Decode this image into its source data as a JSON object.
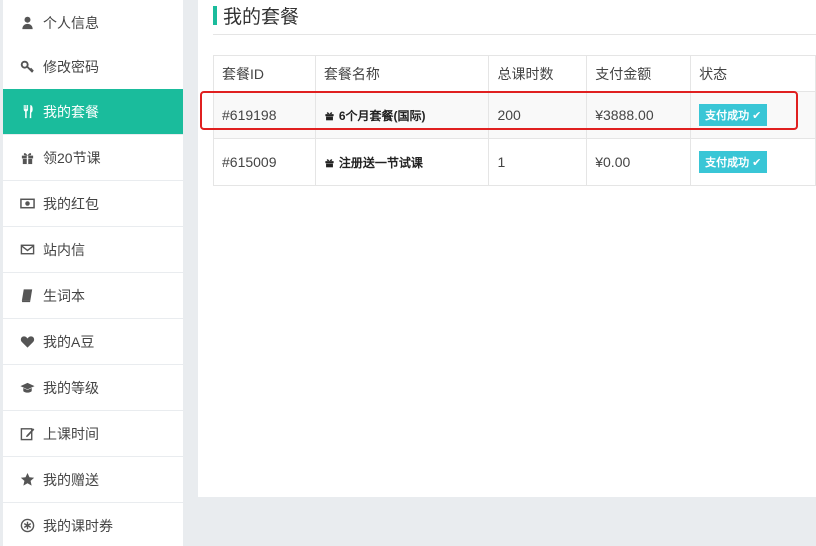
{
  "sidebar": {
    "items": [
      {
        "label": "个人信息",
        "icon": "user-icon"
      },
      {
        "label": "修改密码",
        "icon": "key-icon"
      },
      {
        "label": "我的套餐",
        "icon": "cutlery-icon",
        "active": true
      },
      {
        "label": "领20节课",
        "icon": "gift-icon"
      },
      {
        "label": "我的红包",
        "icon": "money-icon"
      },
      {
        "label": "站内信",
        "icon": "envelope-icon"
      },
      {
        "label": "生词本",
        "icon": "book-icon"
      },
      {
        "label": "我的A豆",
        "icon": "heart-icon"
      },
      {
        "label": "我的等级",
        "icon": "graduation-cap-icon"
      },
      {
        "label": "上课时间",
        "icon": "edit-icon"
      },
      {
        "label": "我的赠送",
        "icon": "star-icon"
      },
      {
        "label": "我的课时券",
        "icon": "coupon-icon"
      }
    ]
  },
  "main": {
    "title": "我的套餐",
    "table": {
      "headers": [
        "套餐ID",
        "套餐名称",
        "总课时数",
        "支付金额",
        "状态"
      ],
      "rows": [
        {
          "id": "#619198",
          "name": "6个月套餐(国际)",
          "hours": "200",
          "amount": "¥3888.00",
          "status": "支付成功"
        },
        {
          "id": "#615009",
          "name": "注册送一节试课",
          "hours": "1",
          "amount": "¥0.00",
          "status": "支付成功"
        }
      ]
    }
  },
  "colors": {
    "accent": "#1abc9c",
    "status_badge": "#39c6d6",
    "highlight": "#e02020"
  }
}
